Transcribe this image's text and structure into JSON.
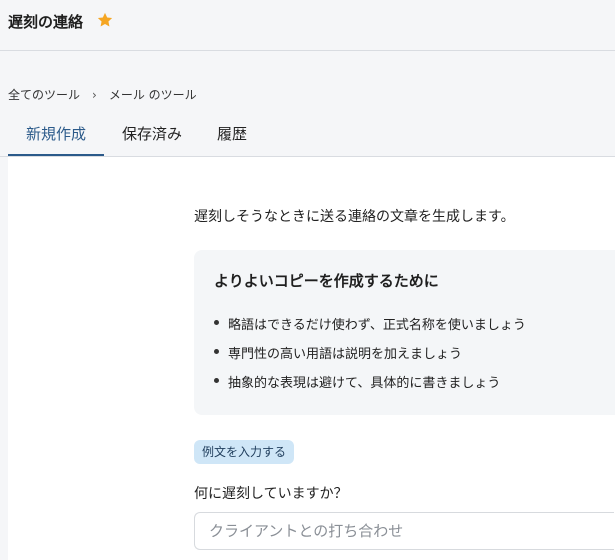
{
  "header": {
    "title": "遅刻の連絡",
    "star_color": "#f5a623"
  },
  "breadcrumb": {
    "items": [
      "全てのツール",
      "メール のツール"
    ],
    "separator": "›"
  },
  "tabs": [
    {
      "label": "新規作成",
      "active": true
    },
    {
      "label": "保存済み",
      "active": false
    },
    {
      "label": "履歴",
      "active": false
    }
  ],
  "main": {
    "description": "遅刻しそうなときに送る連絡の文章を生成します。",
    "tips": {
      "title": "よりよいコピーを作成するために",
      "items": [
        "略語はできるだけ使わず、正式名称を使いましょう",
        "専門性の高い用語は説明を加えましょう",
        "抽象的な表現は避けて、具体的に書きましょう"
      ]
    },
    "example_button": "例文を入力する",
    "question": {
      "label": "何に遅刻していますか？",
      "placeholder": "クライアントとの打ち合わせ",
      "value": ""
    }
  },
  "colors": {
    "accent": "#2b5a8a",
    "example_button_bg": "#cfe6f7"
  }
}
